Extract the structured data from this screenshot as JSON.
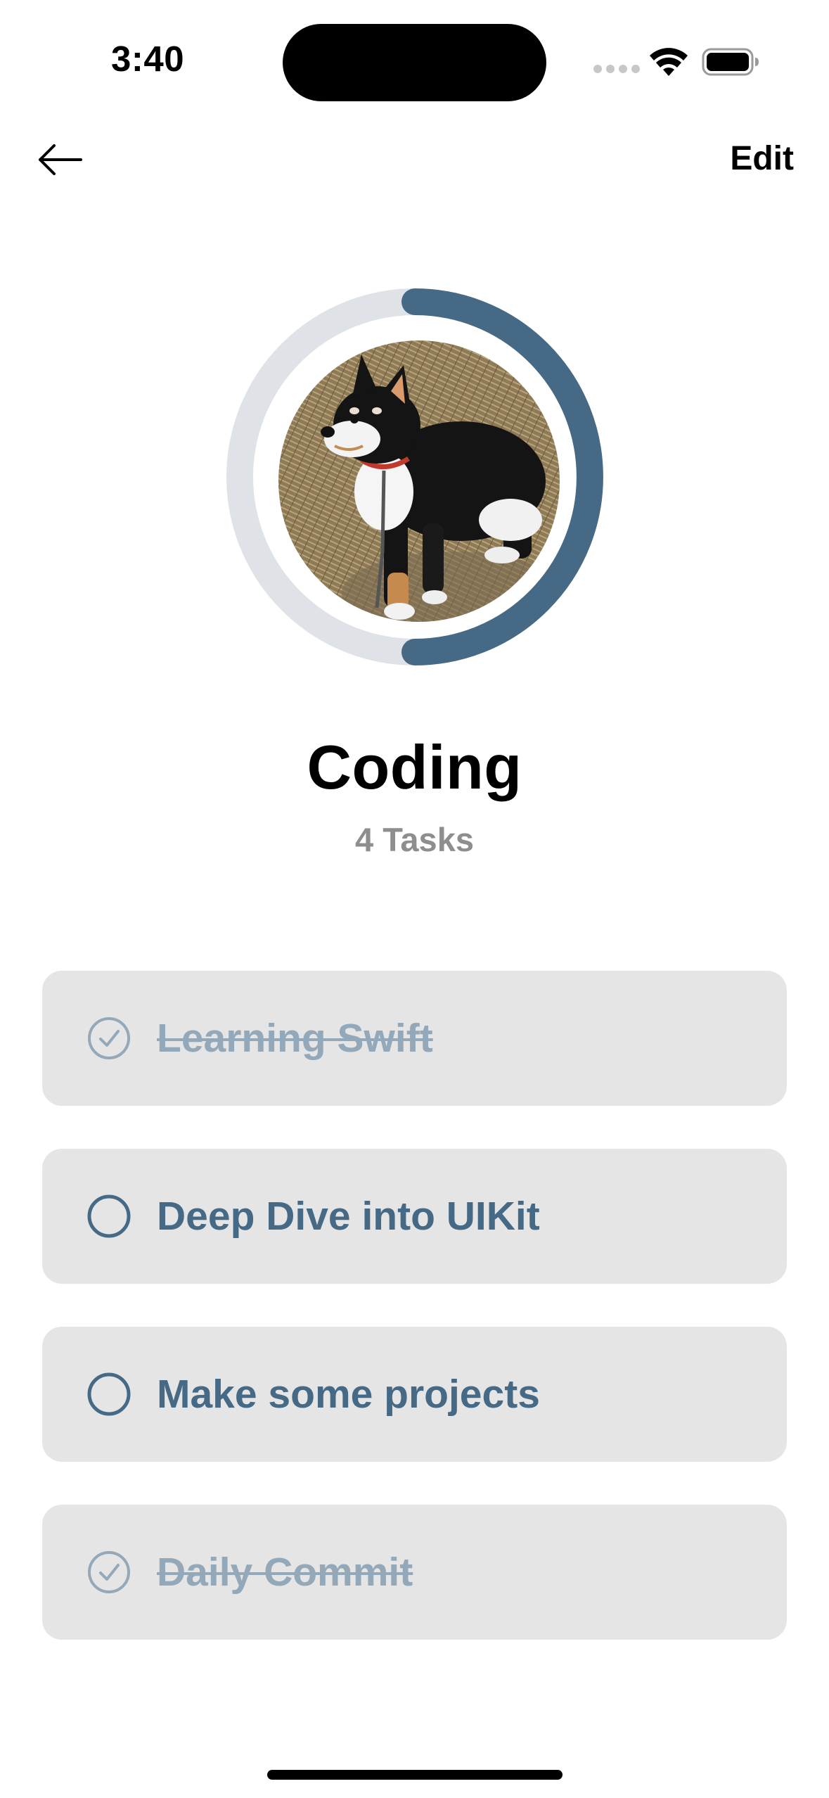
{
  "status_bar": {
    "time": "3:40"
  },
  "nav": {
    "back_icon": "arrow-left-icon",
    "edit_label": "Edit"
  },
  "category": {
    "title": "Coding",
    "subtitle": "4 Tasks",
    "progress": 0.5,
    "accent_color": "#466a86",
    "track_color": "#dfe3e8",
    "photo_description_icon": "shiba-dog-photo"
  },
  "tasks": [
    {
      "label": "Learning Swift",
      "done": true
    },
    {
      "label": "Deep Dive into UIKit",
      "done": false
    },
    {
      "label": "Make some projects",
      "done": false
    },
    {
      "label": "Daily Commit",
      "done": true
    }
  ]
}
